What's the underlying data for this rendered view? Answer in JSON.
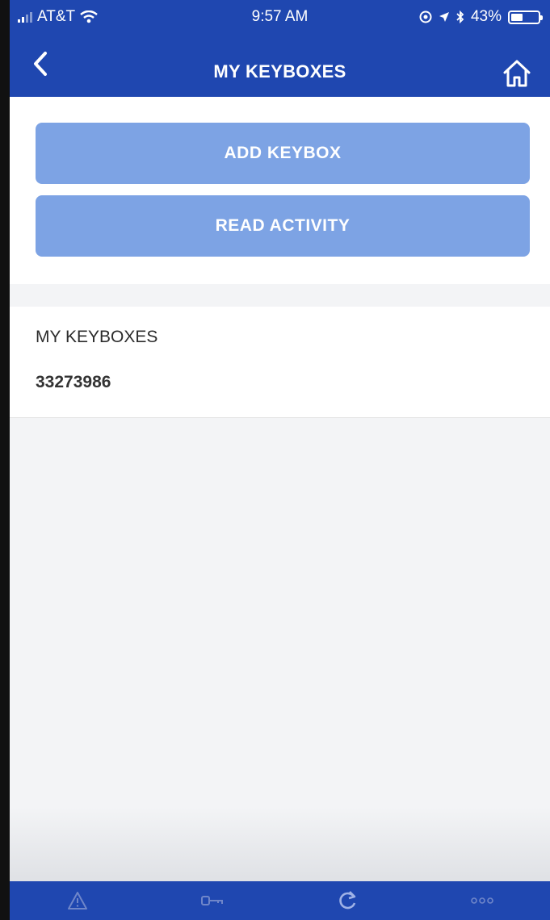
{
  "status_bar": {
    "carrier": "AT&T",
    "time": "9:57 AM",
    "battery_percent": "43%",
    "battery_level": 0.43
  },
  "nav": {
    "title": "MY KEYBOXES",
    "back_icon": "chevron-left-icon",
    "home_icon": "home-icon"
  },
  "actions": {
    "add_keybox": "ADD KEYBOX",
    "read_activity": "READ ACTIVITY"
  },
  "keyboxes": {
    "heading": "MY KEYBOXES",
    "items": [
      "33273986"
    ]
  },
  "tabbar": {
    "tabs": [
      {
        "icon": "alert-icon"
      },
      {
        "icon": "key-icon"
      },
      {
        "icon": "sync-icon"
      },
      {
        "icon": "more-icon"
      }
    ]
  },
  "colors": {
    "brand_blue": "#1f47b0",
    "button_blue": "#7da3e4",
    "background": "#f3f4f6"
  }
}
